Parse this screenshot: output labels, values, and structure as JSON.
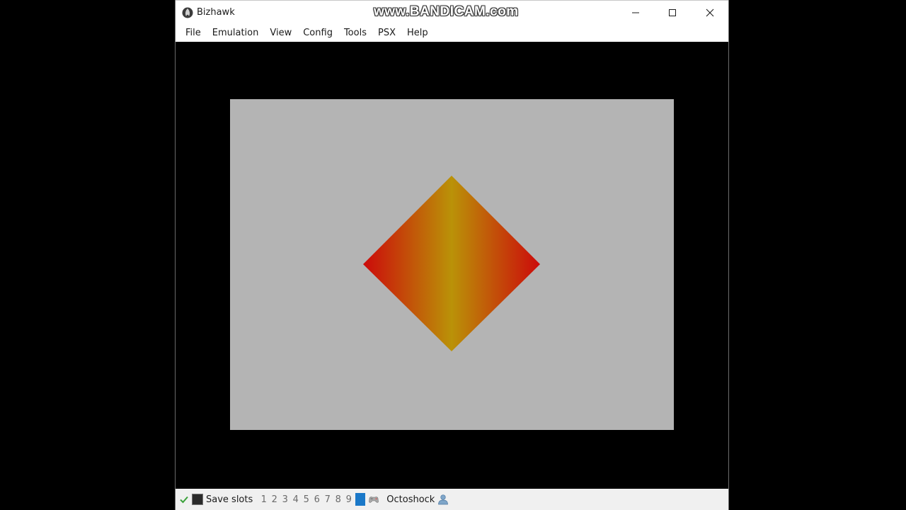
{
  "window": {
    "title": "Bizhawk",
    "watermark": "www.BANDICAM.com"
  },
  "menu": {
    "items": [
      "File",
      "Emulation",
      "View",
      "Config",
      "Tools",
      "PSX",
      "Help"
    ]
  },
  "game": {
    "background_color": "#b4b4b4",
    "shape": "diamond",
    "gradient_colors": [
      "#cc0a0a",
      "#ba9208",
      "#cc0a0a"
    ]
  },
  "statusbar": {
    "save_label": "Save slots",
    "slots": [
      "1",
      "2",
      "3",
      "4",
      "5",
      "6",
      "7",
      "8",
      "9"
    ],
    "active_slot": "0",
    "core_label": "Octoshock",
    "icons": [
      "check-icon",
      "led-icon",
      "controller-icon",
      "user-icon"
    ]
  },
  "colors": {
    "accent": "#1a78c8",
    "check": "#3aa13a"
  }
}
